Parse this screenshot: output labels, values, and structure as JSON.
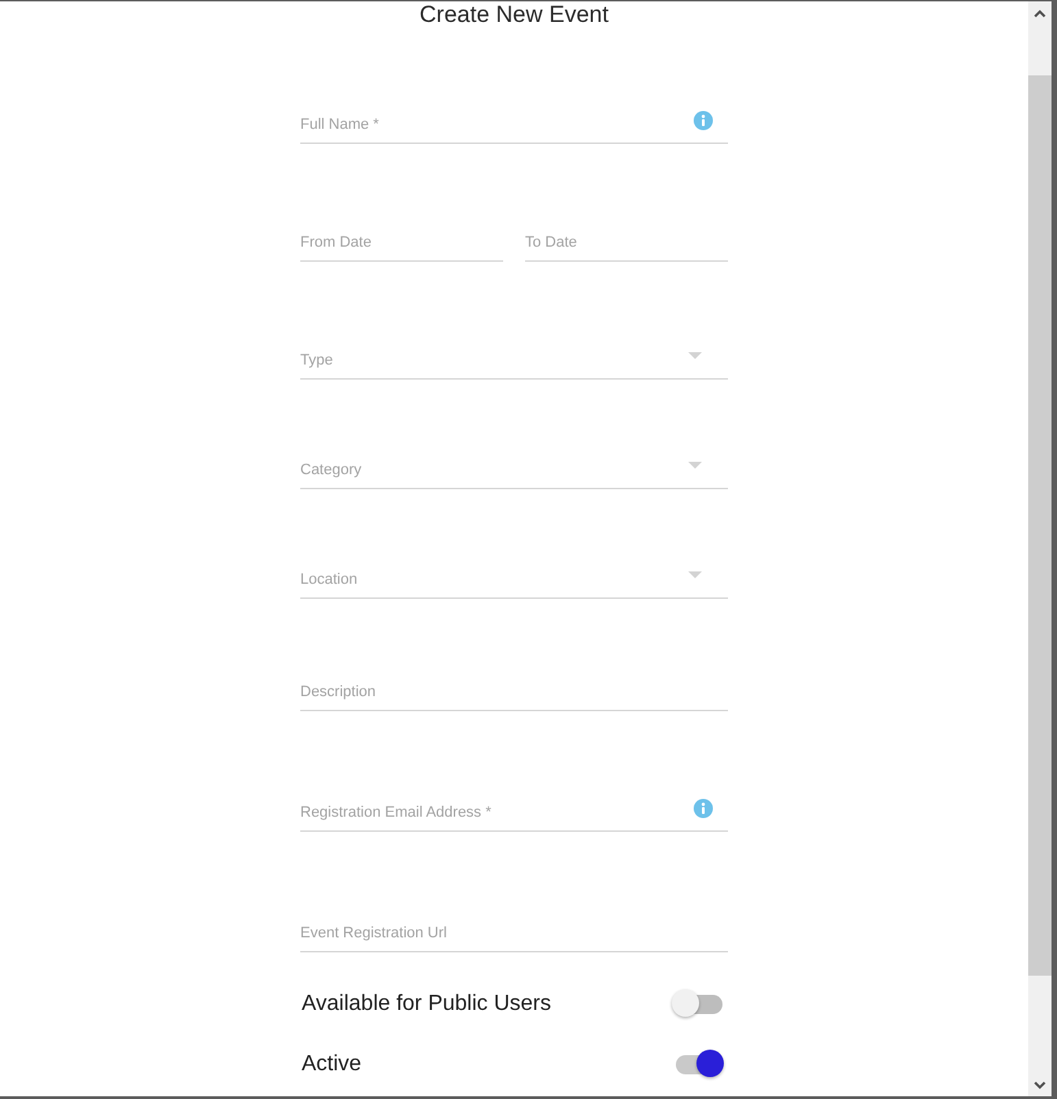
{
  "dialog": {
    "title": "Create New Event"
  },
  "form_rows": [
    {
      "fields": [
        {
          "kind": "text",
          "placeholder": "Full Name *",
          "info": true
        }
      ]
    },
    {
      "fields": [
        {
          "kind": "text",
          "placeholder": "From Date",
          "info": false
        },
        {
          "kind": "text",
          "placeholder": "To Date",
          "info": false
        }
      ]
    },
    {
      "fields": [
        {
          "kind": "select",
          "placeholder": "Type",
          "info": false
        }
      ]
    },
    {
      "fields": [
        {
          "kind": "select",
          "placeholder": "Category",
          "info": false
        }
      ]
    },
    {
      "fields": [
        {
          "kind": "select",
          "placeholder": "Location",
          "info": false
        }
      ]
    },
    {
      "fields": [
        {
          "kind": "text",
          "placeholder": "Description",
          "info": false
        }
      ]
    },
    {
      "fields": [
        {
          "kind": "text",
          "placeholder": "Registration Email Address *",
          "info": true
        }
      ]
    },
    {
      "fields": [
        {
          "kind": "text",
          "placeholder": "Event Registration Url",
          "info": false
        }
      ]
    }
  ],
  "switches": [
    {
      "label": "Available for Public Users",
      "on": false
    },
    {
      "label": "Active",
      "on": true
    }
  ]
}
